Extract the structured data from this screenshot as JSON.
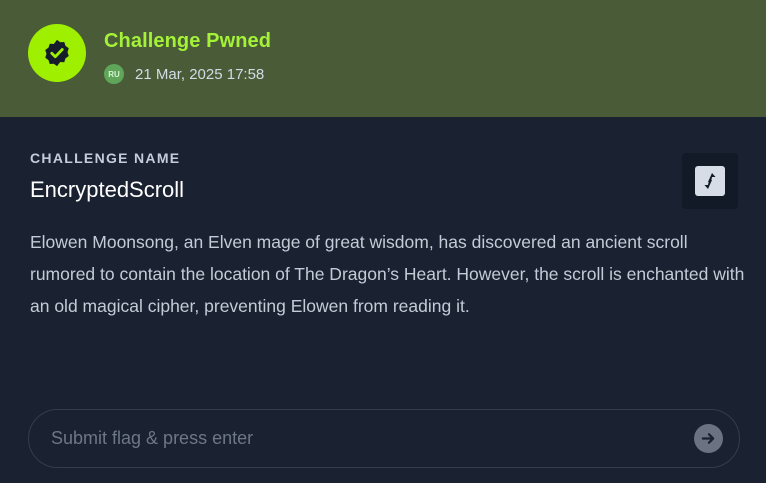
{
  "banner": {
    "title": "Challenge Pwned",
    "region": "RU",
    "timestamp": "21 Mar, 2025 17:58",
    "badge_icon": "verified-badge-icon",
    "accent_color": "#9fef00"
  },
  "challenge": {
    "section_label": "CHALLENGE NAME",
    "name": "EncryptedScroll",
    "description": "Elowen Moonsong, an Elven mage of great wisdom, has discovered an ancient scroll rumored to contain the location of The Dragon’s Heart. However, the scroll is enchanted with an old magical cipher, preventing Elowen from reading it.",
    "action_icon": "refresh-arrows-icon"
  },
  "flag": {
    "value": "",
    "placeholder": "Submit flag & press enter",
    "submit_icon": "arrow-right-icon"
  }
}
